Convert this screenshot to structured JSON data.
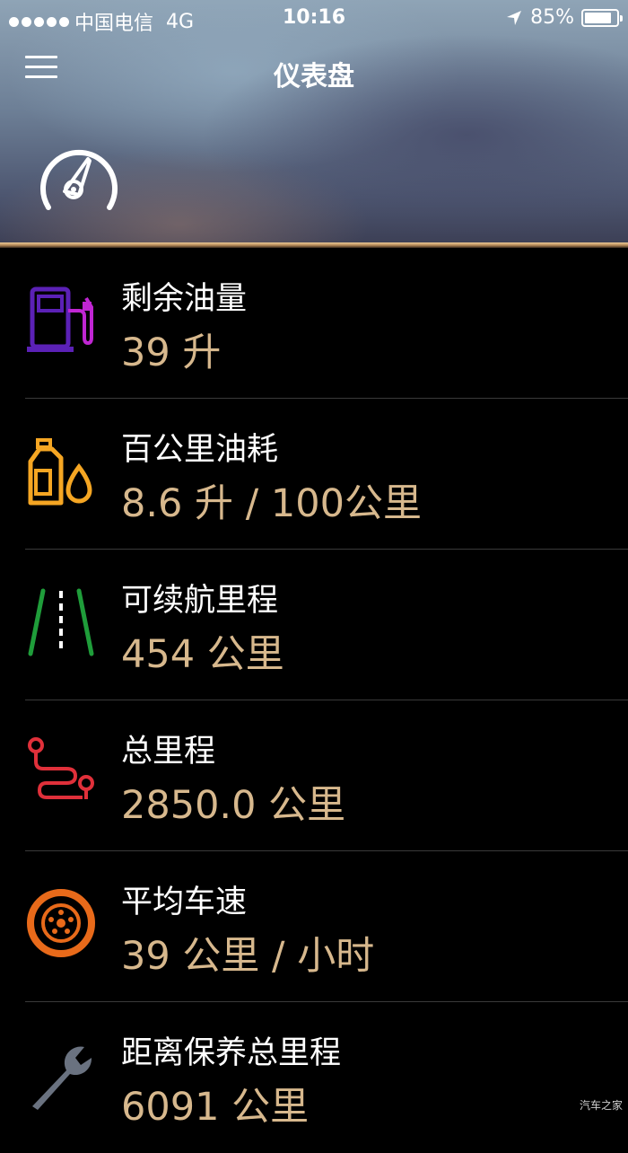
{
  "status_bar": {
    "carrier": "中国电信",
    "network": "4G",
    "time": "10:16",
    "battery": "85%",
    "battery_level": 0.85
  },
  "header": {
    "title": "仪表盘"
  },
  "items": [
    {
      "label": "剩余油量",
      "value": "39 升",
      "icon": "fuel-pump-icon",
      "color": "#5b21b6"
    },
    {
      "label": "百公里油耗",
      "value": "8.6 升 / 100公里",
      "icon": "oil-can-icon",
      "color": "#f5a623"
    },
    {
      "label": "可续航里程",
      "value": "454 公里",
      "icon": "road-icon",
      "color": "#1f9d3a"
    },
    {
      "label": "总里程",
      "value": "2850.0 公里",
      "icon": "route-icon",
      "color": "#e0303a"
    },
    {
      "label": "平均车速",
      "value": "39 公里 / 小时",
      "icon": "wheel-icon",
      "color": "#e86a1a"
    },
    {
      "label": "距离保养总里程",
      "value": "6091 公里",
      "icon": "wrench-icon",
      "color": "#6a7280"
    }
  ],
  "watermark": "汽车之家"
}
